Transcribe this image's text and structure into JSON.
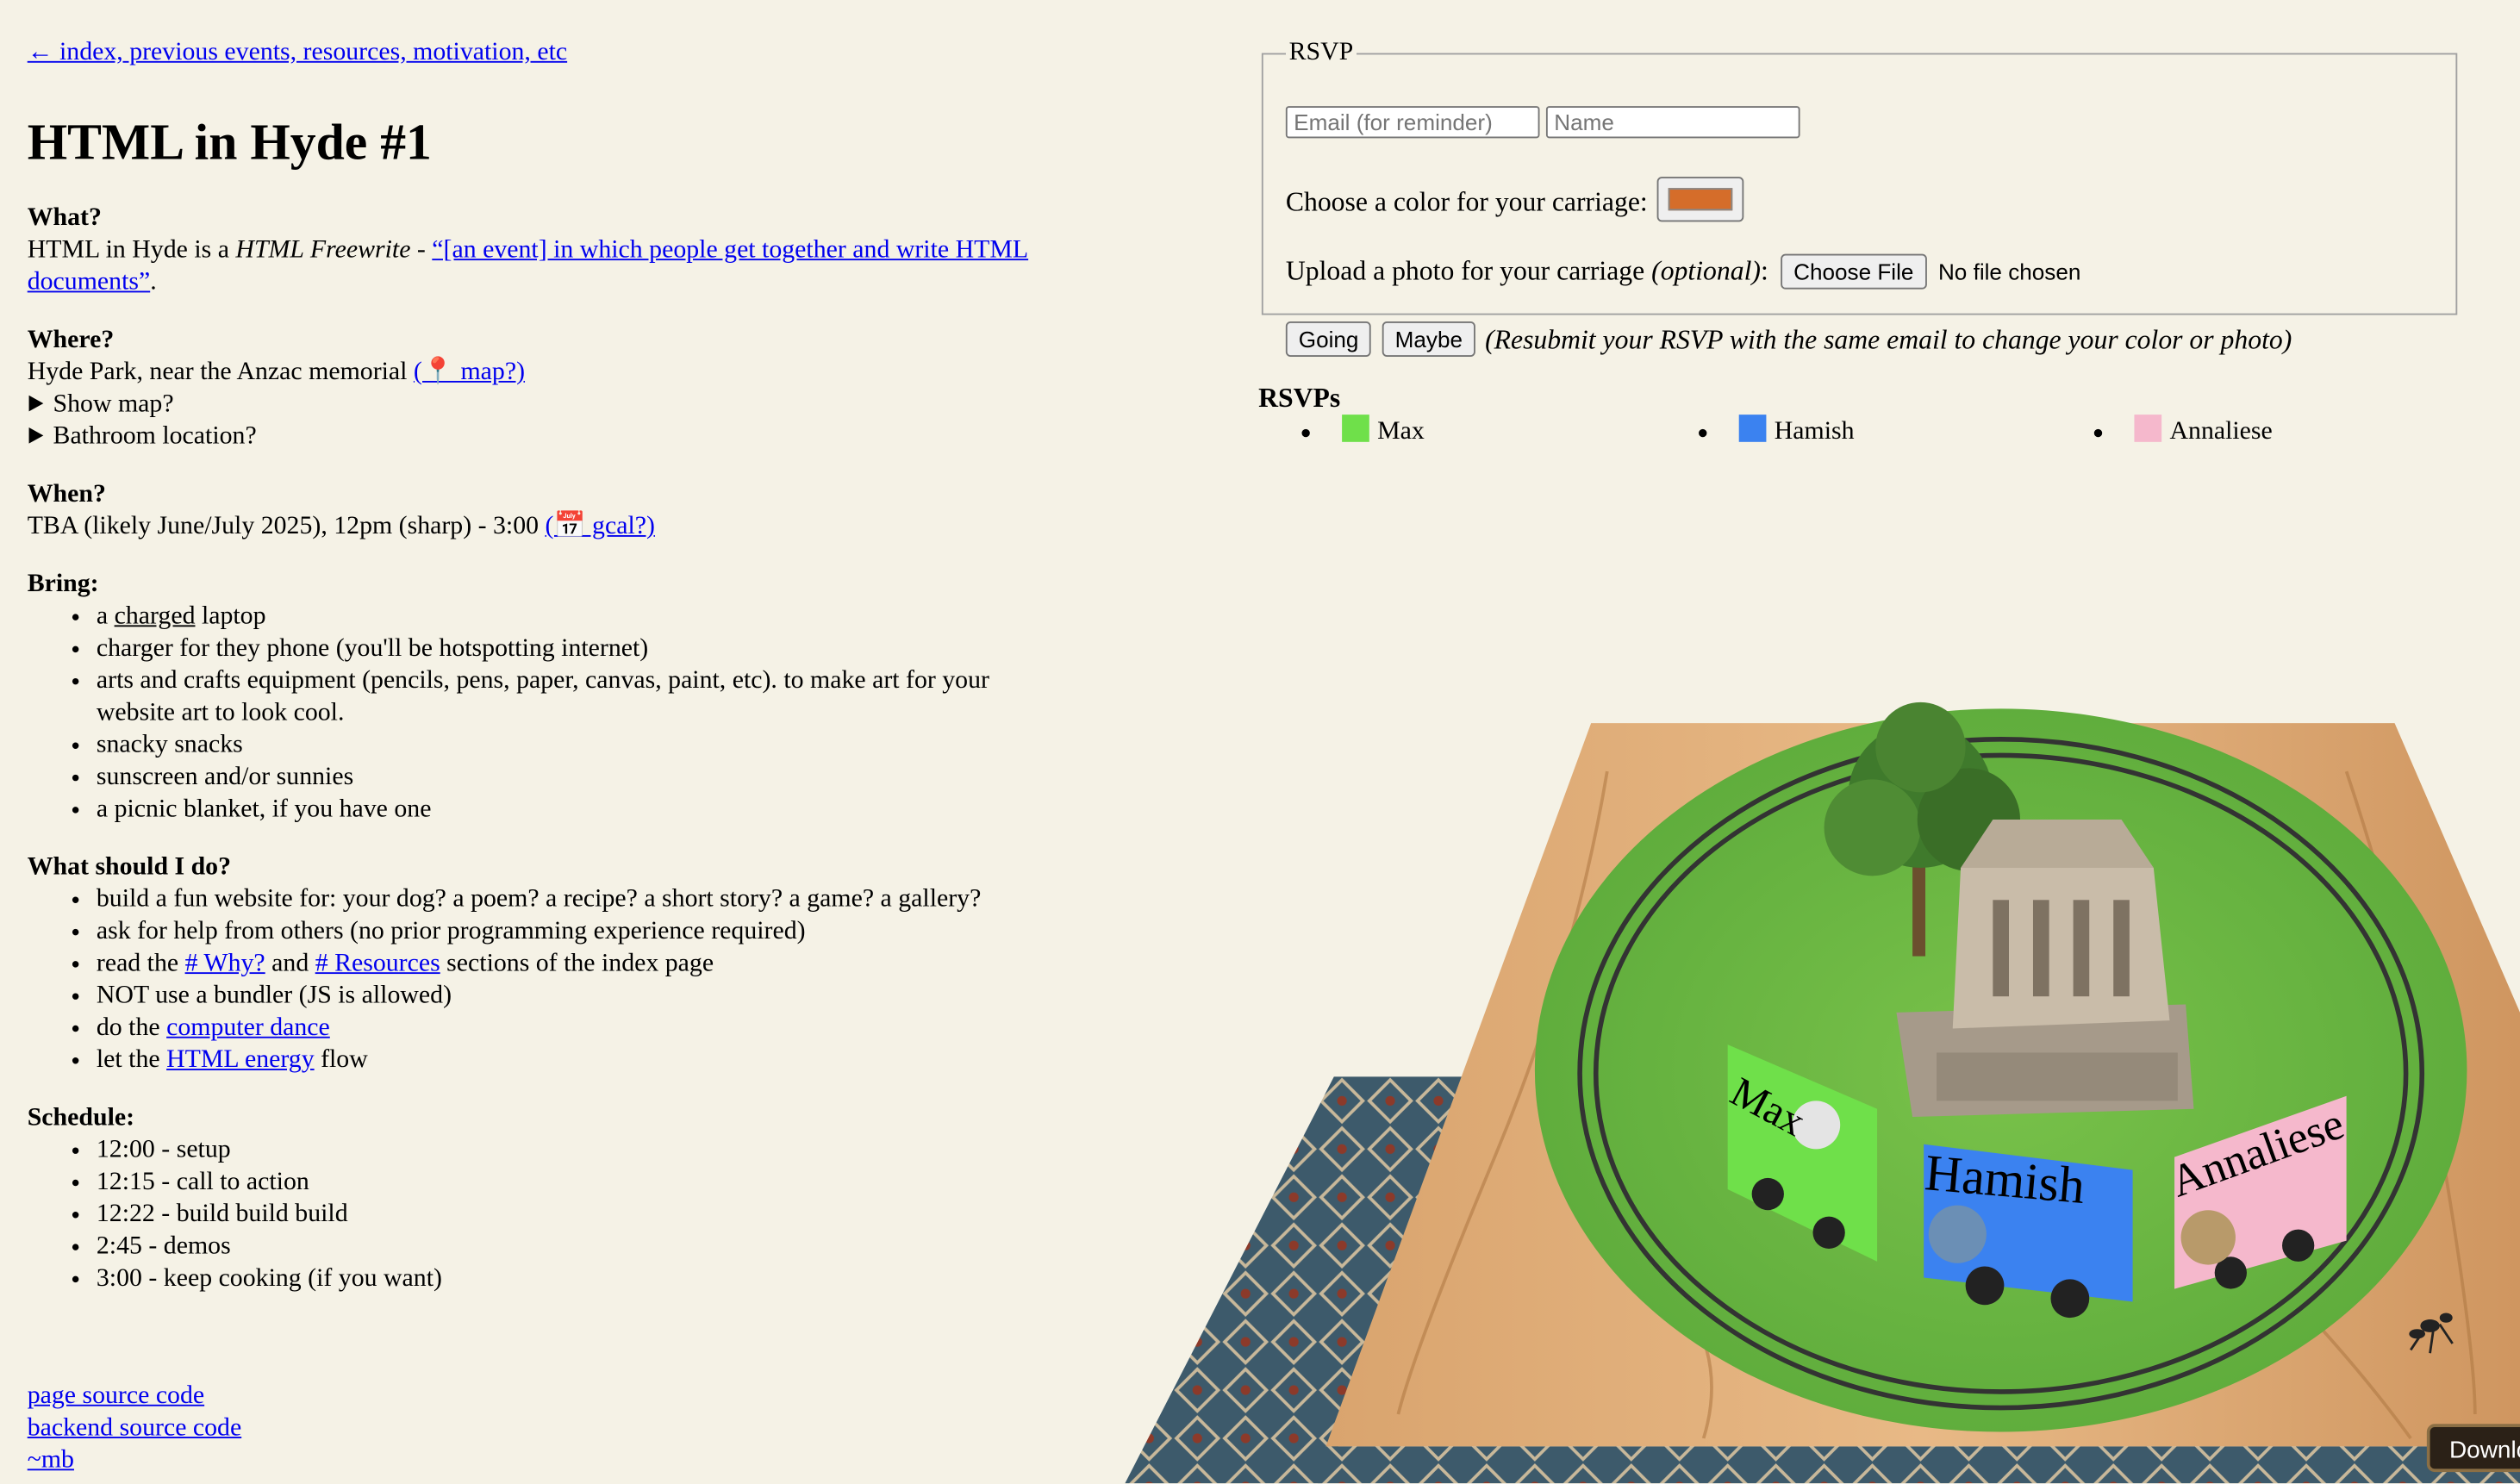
{
  "nav": {
    "back_link": "← index, previous events, resources, motivation, etc"
  },
  "page_title": "HTML in Hyde #1",
  "what": {
    "heading": "What?",
    "text_before": "HTML in Hyde is a ",
    "emphasis": "HTML Freewrite",
    "dash": " - ",
    "quote_link": "“[an event] in which people get together and write HTML documents”",
    "end": "."
  },
  "where": {
    "heading": "Where?",
    "text": "Hyde Park, near the Anzac memorial ",
    "map_link": "(📍 map?)",
    "show_map": "Show map?",
    "bathroom": "Bathroom location?"
  },
  "when": {
    "heading": "When?",
    "text": "TBA (likely June/July 2025), 12pm (sharp) - 3:00 ",
    "gcal_link": "(📅 gcal?)"
  },
  "bring": {
    "heading": "Bring:",
    "item1_a": "a ",
    "item1_b": "charged",
    "item1_c": " laptop",
    "items": [
      "charger for they phone (you'll be hotspotting internet)",
      "arts and crafts equipment (pencils, pens, paper, canvas, paint, etc). to make art for your website art to look cool.",
      "snacky snacks",
      "sunscreen and/or sunnies",
      "a picnic blanket, if you have one"
    ]
  },
  "todo": {
    "heading": "What should I do?",
    "items": [
      "build a fun website for: your dog? a poem? a recipe? a short story? a game? a gallery?",
      "ask for help from others (no prior programming experience required)"
    ],
    "read_a": "read the ",
    "read_link1": "# Why?",
    "read_b": " and ",
    "read_link2": "# Resources",
    "read_c": " sections of the index page",
    "bundler": "NOT use a bundler (JS is allowed)",
    "dance_a": "do the ",
    "dance_link": "computer dance",
    "energy_a": "let the ",
    "energy_link": "HTML energy",
    "energy_b": " flow"
  },
  "schedule": {
    "heading": "Schedule:",
    "items": [
      "12:00 - setup",
      "12:15 - call to action",
      "12:22 - build build build",
      "2:45 - demos",
      "3:00 - keep cooking (if you want)"
    ]
  },
  "footer": {
    "page_source": "page source code",
    "backend_source": "backend source code",
    "home": "~mb"
  },
  "rsvp_form": {
    "legend": "RSVP",
    "email_placeholder": "Email (for reminder)",
    "name_placeholder": "Name",
    "color_label": "Choose a color for your carriage:",
    "color_value": "#d56d2a",
    "photo_label": "Upload a photo for your carriage ",
    "photo_optional": "(optional)",
    "photo_colon": ":",
    "choose_file": "Choose File",
    "no_file": "No file chosen",
    "going": "Going",
    "maybe": "Maybe",
    "note": "(Resubmit your RSVP with the same email to change your color or photo)"
  },
  "rsvps": {
    "title": "RSVPs",
    "people": [
      {
        "name": "Max",
        "color": "#6fe04a"
      },
      {
        "name": "Hamish",
        "color": "#3b82f0"
      },
      {
        "name": "Annaliese",
        "color": "#f5b8cc"
      }
    ]
  },
  "download_label": "Download"
}
